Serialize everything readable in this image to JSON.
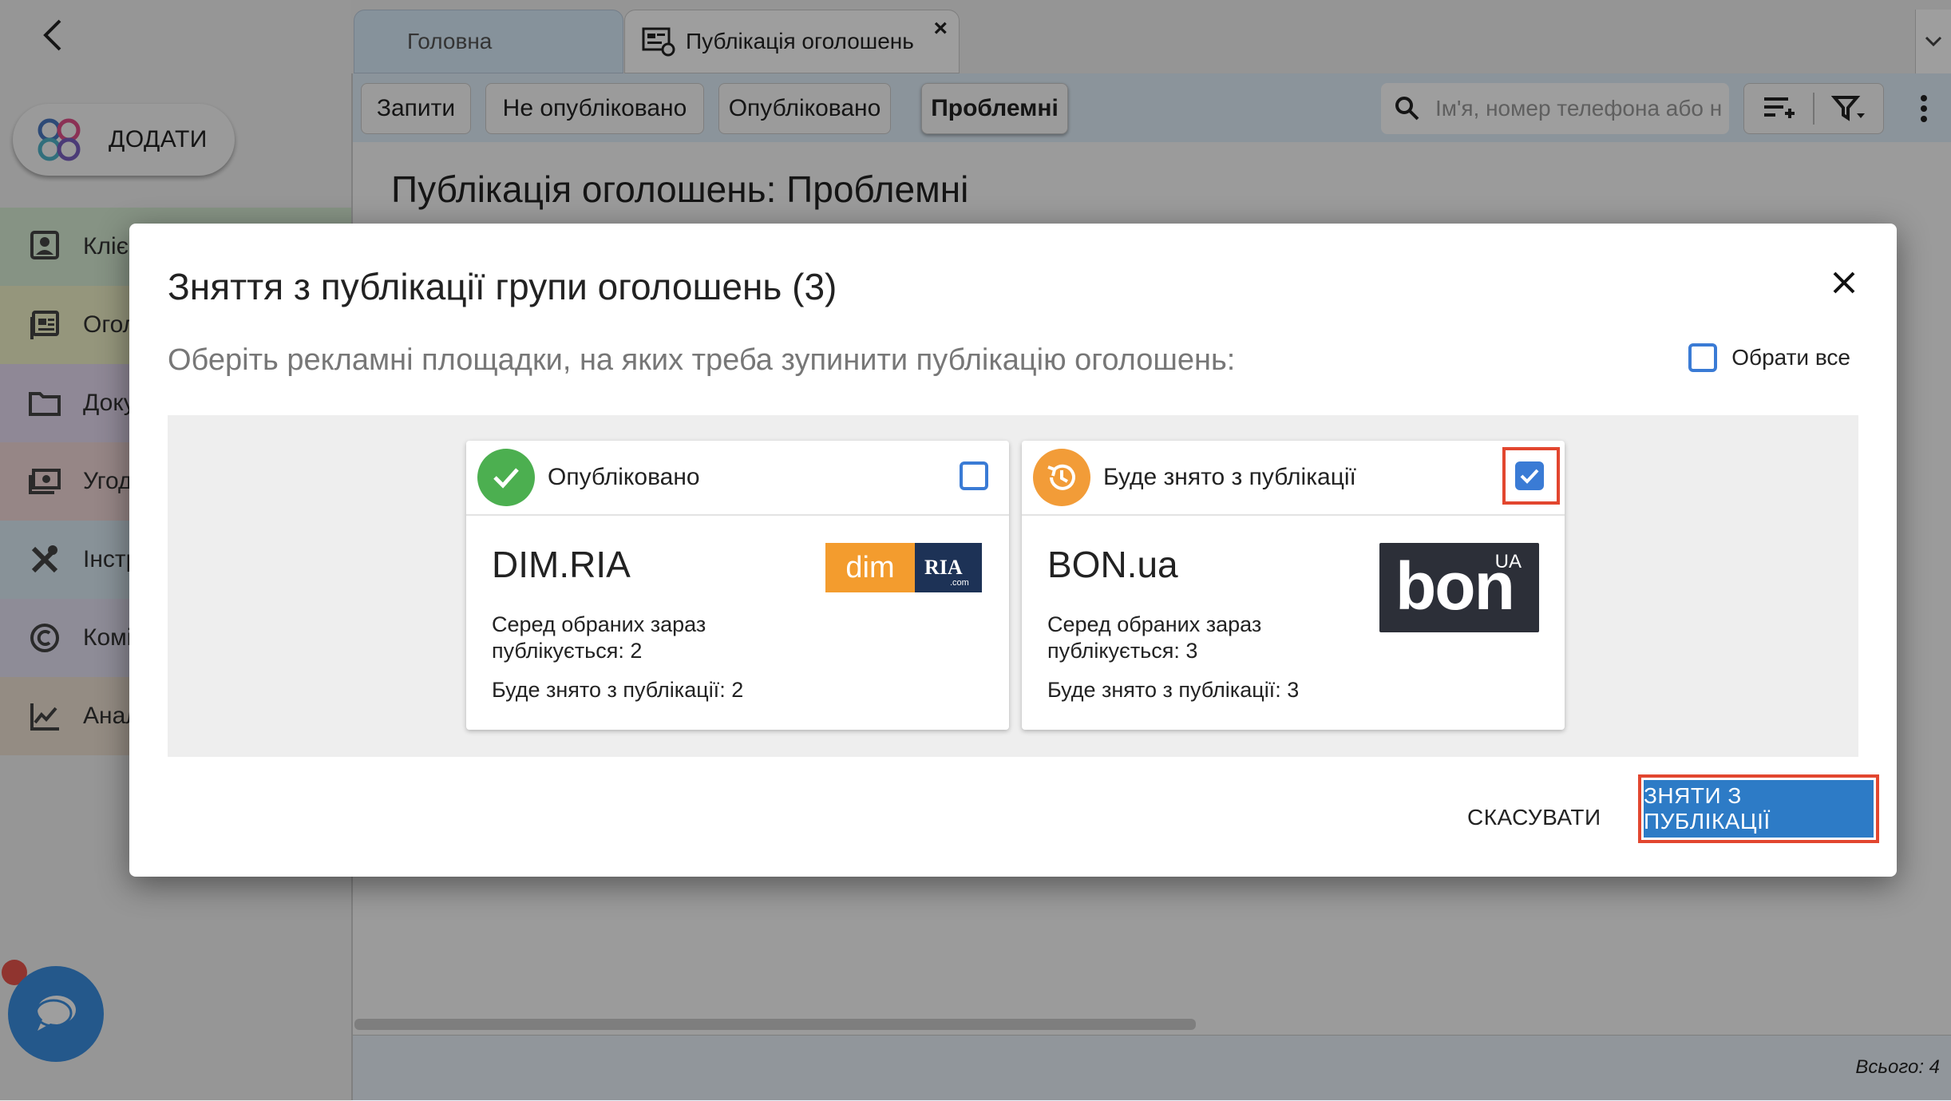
{
  "sidebar": {
    "add_label": "ДОДАТИ",
    "items": [
      {
        "label": "Клієнти",
        "icon": "contacts-icon",
        "color": "#d8eed5"
      },
      {
        "label": "Оголошення",
        "icon": "listings-icon",
        "color": "#f1f2c8"
      },
      {
        "label": "Документи",
        "icon": "folder-icon",
        "color": "#e7dcf3"
      },
      {
        "label": "Угоди",
        "icon": "money-icon",
        "color": "#f3d9d9"
      },
      {
        "label": "Інструменти",
        "icon": "tools-icon",
        "color": "#dcecf6"
      },
      {
        "label": "Комісії",
        "icon": "copyright-icon",
        "color": "#e6e3f4"
      },
      {
        "label": "Аналітика",
        "icon": "analytics-icon",
        "color": "#efe2d3"
      }
    ]
  },
  "tabs": {
    "home": "Головна",
    "active": "Публікація оголошень"
  },
  "toolbar": {
    "chips": [
      "Запити",
      "Не опубліковано",
      "Опубліковано",
      "Проблемні"
    ],
    "search_placeholder": "Ім'я, номер телефона або н"
  },
  "page": {
    "title": "Публікація оголошень: Проблемні",
    "total": "Всього: 4"
  },
  "dialog": {
    "title": "Зняття з публікації групи оголошень (3)",
    "subtitle": "Оберіть рекламні площадки, на яких треба зупинити публікацію оголошень:",
    "select_all_label": "Обрати все",
    "cards": [
      {
        "status": "Опубліковано",
        "status_color": "#4caf50",
        "name": "DIM.RIA",
        "publishing_line1": "Серед обраних зараз",
        "publishing_line2": "публікується: 2",
        "removing": "Буде знято з публікації: 2",
        "logo_text_left": "dim",
        "logo_text_right": "RIA",
        "logo_text_small": ".com",
        "checked": false
      },
      {
        "status": "Буде знято з публікації",
        "status_color": "#f29c38",
        "name": "BON.ua",
        "publishing_line1": "Серед обраних зараз",
        "publishing_line2": "публікується: 3",
        "removing": "Буде знято з публікації: 3",
        "logo_text": "bon",
        "logo_badge": "UA",
        "checked": true
      }
    ],
    "cancel_label": "СКАСУВАТИ",
    "submit_label": "ЗНЯТИ З ПУБЛІКАЦІЇ"
  }
}
